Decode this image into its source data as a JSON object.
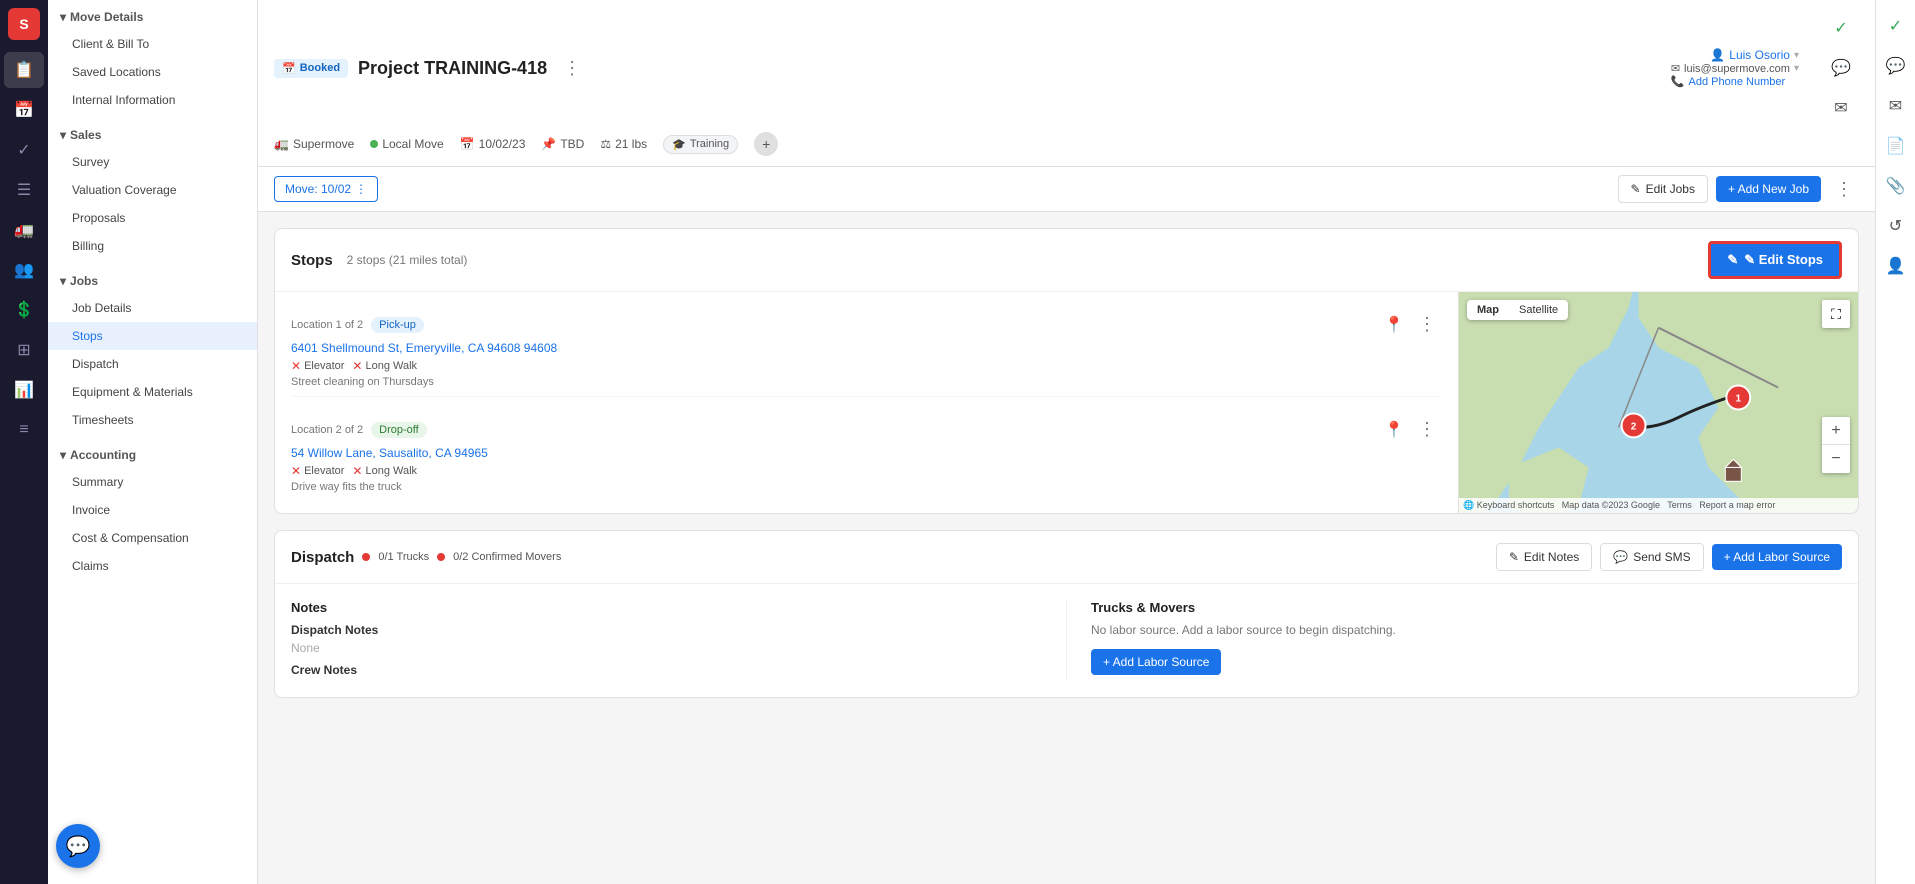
{
  "app": {
    "logo": "S",
    "title": "Supermove"
  },
  "sidebar": {
    "groups": [
      {
        "label": "Move Details",
        "items": [
          {
            "label": "Client & Bill To",
            "active": false
          },
          {
            "label": "Saved Locations",
            "active": false
          },
          {
            "label": "Internal Information",
            "active": false
          }
        ]
      },
      {
        "label": "Sales",
        "items": [
          {
            "label": "Survey",
            "active": false
          },
          {
            "label": "Valuation Coverage",
            "active": false
          },
          {
            "label": "Proposals",
            "active": false
          },
          {
            "label": "Billing",
            "active": false
          }
        ]
      },
      {
        "label": "Jobs",
        "items": [
          {
            "label": "Job Details",
            "active": false
          },
          {
            "label": "Stops",
            "active": true
          },
          {
            "label": "Dispatch",
            "active": false
          },
          {
            "label": "Equipment & Materials",
            "active": false
          },
          {
            "label": "Timesheets",
            "active": false
          }
        ]
      },
      {
        "label": "Accounting",
        "items": [
          {
            "label": "Summary",
            "active": false
          },
          {
            "label": "Invoice",
            "active": false
          },
          {
            "label": "Cost & Compensation",
            "active": false
          },
          {
            "label": "Claims",
            "active": false
          }
        ]
      }
    ]
  },
  "header": {
    "status_badge": "Booked",
    "project_title": "Project TRAINING-418",
    "company": "Supermove",
    "move_type": "Local Move",
    "date": "10/02/23",
    "tip": "TBD",
    "weight": "21 lbs",
    "tag": "Training",
    "user_name": "Luis Osorio",
    "user_email": "luis@supermove.com",
    "add_phone": "Add Phone Number"
  },
  "subheader": {
    "move_label": "Move: 10/02",
    "edit_jobs_label": "Edit Jobs",
    "add_job_label": "+ Add New Job"
  },
  "stops_section": {
    "title": "Stops",
    "subtitle": "2 stops (21 miles total)",
    "edit_button": "✎ Edit Stops",
    "locations": [
      {
        "index": "Location 1 of 2",
        "badge": "Pick-up",
        "badge_type": "pickup",
        "address": "6401 Shellmound St, Emeryville, CA 94608 94608",
        "tags": [
          "Elevator",
          "Long Walk"
        ],
        "note": "Street cleaning on Thursdays"
      },
      {
        "index": "Location 2 of 2",
        "badge": "Drop-off",
        "badge_type": "dropoff",
        "address": "54 Willow Lane, Sausalito, CA 94965",
        "tags": [
          "Elevator",
          "Long Walk"
        ],
        "note": "Drive way fits the truck"
      }
    ],
    "map": {
      "tab_map": "Map",
      "tab_satellite": "Satellite",
      "attrib": "Keyboard shortcuts   Map data ©2023 Google   Terms   Report a map error"
    }
  },
  "dispatch_section": {
    "title": "Dispatch",
    "trucks_status": "0/1 Trucks",
    "movers_status": "0/2 Confirmed Movers",
    "edit_notes_label": "Edit Notes",
    "send_sms_label": "Send SMS",
    "add_labor_label": "+ Add Labor Source",
    "notes": {
      "title": "Notes",
      "dispatch_notes_label": "Dispatch Notes",
      "dispatch_notes_value": "None",
      "crew_notes_label": "Crew Notes"
    },
    "trucks_movers": {
      "title": "Trucks & Movers",
      "no_labor_text": "No labor source. Add a labor source to begin dispatching.",
      "add_labor_btn": "+ Add Labor Source"
    }
  },
  "icons": {
    "calendar": "📅",
    "truck": "🚛",
    "weight": "⚖",
    "pencil": "✎",
    "plus": "+",
    "chat": "💬",
    "map_pin": "📍",
    "person": "👤",
    "mail": "✉",
    "phone": "📞",
    "check": "✓",
    "menu": "☰",
    "expand": "⛶",
    "zoom_plus": "+",
    "zoom_minus": "−",
    "three_dot_h": "⋯",
    "three_dot_v": "⋮"
  }
}
